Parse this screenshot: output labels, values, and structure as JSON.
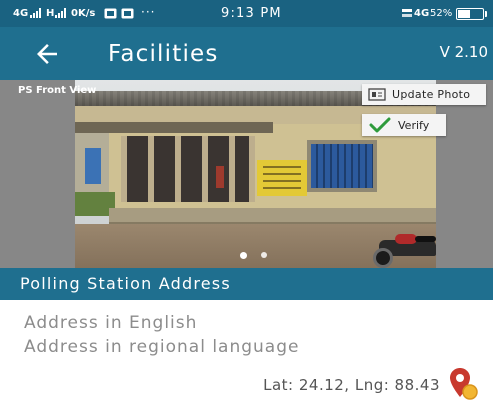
{
  "status_bar": {
    "network_1": "4G",
    "network_2": "H",
    "data_speed": "0K/s",
    "overflow": "···",
    "time": "9:13 PM",
    "network_right": "4G",
    "battery": "52%",
    "signal_icon": "signal-bars-icon",
    "notification_icons": [
      "notification-photo-icon",
      "notification-gallery-icon"
    ],
    "volte_icon": "volte-icon",
    "battery_icon": "battery-icon"
  },
  "app_bar": {
    "back_icon": "arrow-left-icon",
    "title": "Facilities",
    "version": "V 2.10"
  },
  "photo_carousel": {
    "label": "PS Front View",
    "update_photo_label": "Update Photo",
    "update_photo_icon": "photo-icon",
    "verify_label": "Verify",
    "verify_icon": "checkmark-icon",
    "page_count": 2,
    "current_page": 1
  },
  "section": {
    "title": "Polling Station Address"
  },
  "address": {
    "english": "Address in English",
    "regional": "Address in regional language"
  },
  "location": {
    "coordinates": "Lat: 24.12, Lng: 88.43",
    "icon": "map-pin-icon"
  },
  "colors": {
    "status_bar": "#1a6281",
    "primary": "#1f6f8f",
    "photo_background": "#878787",
    "secondary_text": "#8c8c8c",
    "coordinate_text": "#555555",
    "verify_green": "#2e9b3c",
    "pin_red": "#c8392e",
    "pin_yellow": "#f2b632",
    "text_on_primary": "#ffffff"
  }
}
